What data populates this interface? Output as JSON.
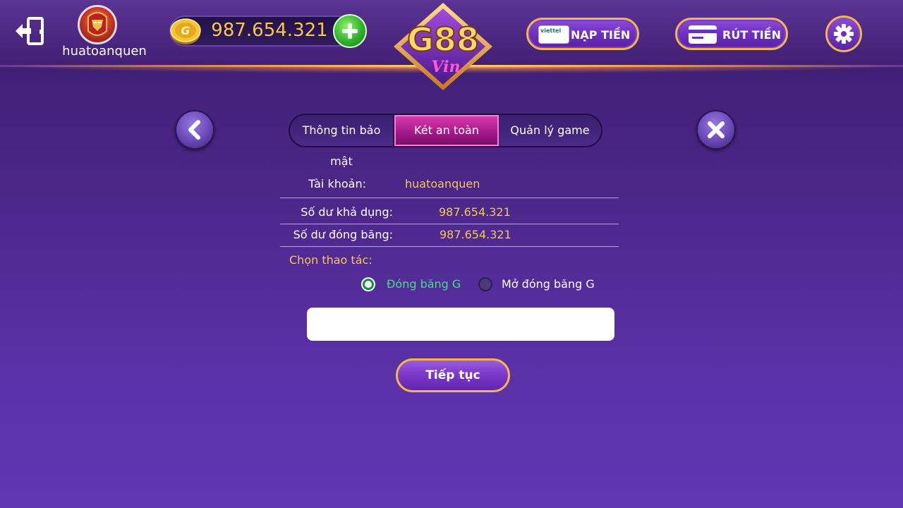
{
  "header": {
    "username": "huatoanquen",
    "balance": "987.654.321",
    "logo_text": "G88",
    "logo_sub": "Vin",
    "nap_label": "NẠP TIỀN",
    "nap_icon_text": "viettel",
    "rut_label": "RÚT TIỀN"
  },
  "tabs": [
    {
      "label": "Thông tin bảo mật",
      "active": false
    },
    {
      "label": "Két an toàn",
      "active": true
    },
    {
      "label": "Quản lý game",
      "active": false
    }
  ],
  "info": {
    "account_label": "Tài khoản:",
    "account_value": "huatoanquen",
    "available_label": "Số dư khả dụng:",
    "available_value": "987.654.321",
    "frozen_label": "Số dư đóng băng:",
    "frozen_value": "987.654.321"
  },
  "action": {
    "choose_label": "Chọn thao tác:",
    "option_freeze": "Đóng băng G",
    "option_unfreeze": "Mở đóng băng G",
    "selected": "freeze",
    "amount_value": "",
    "amount_placeholder": ""
  },
  "continue_label": "Tiếp tục",
  "colors": {
    "gold": "#f7c848",
    "green": "#3ee07a",
    "active_tab": "#b0208f",
    "background": "#4a2686"
  }
}
